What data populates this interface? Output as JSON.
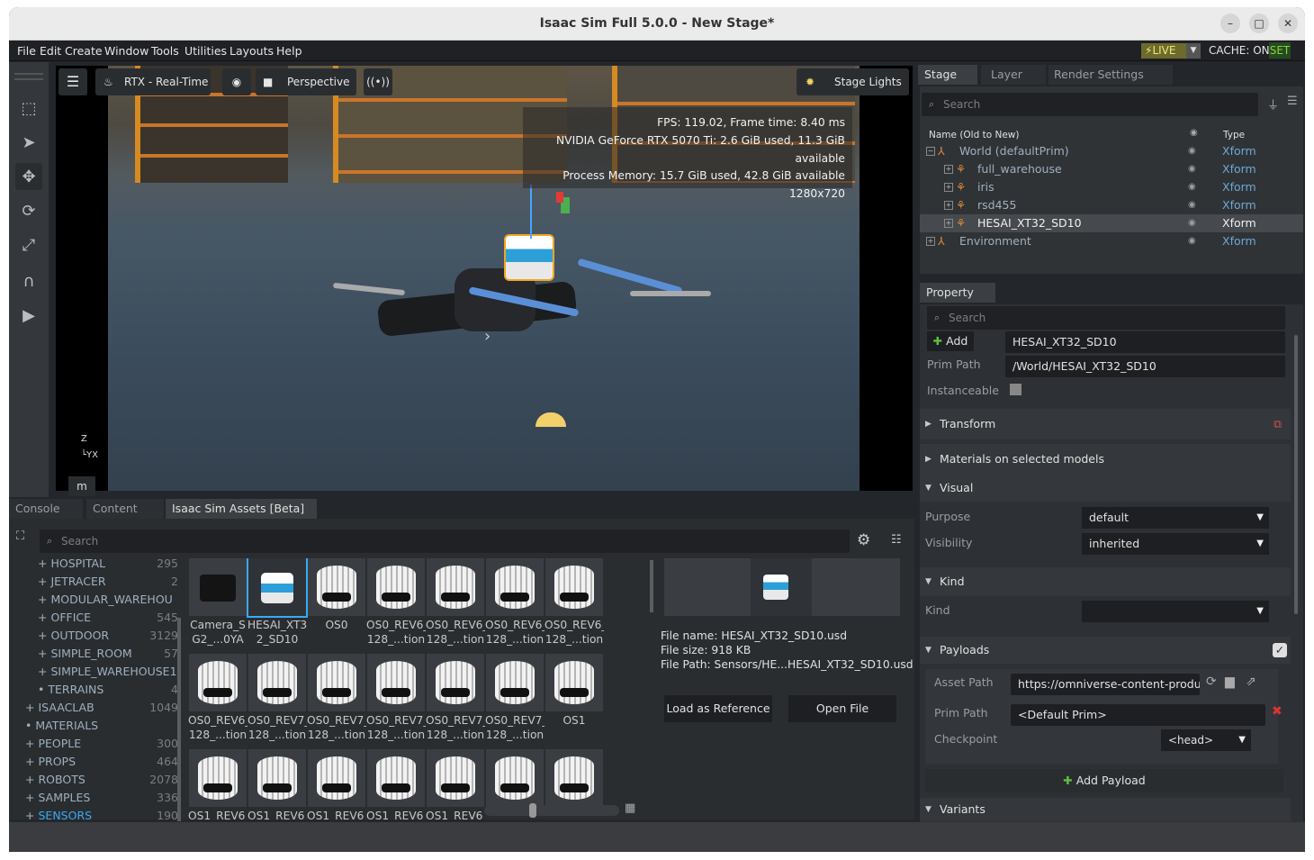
{
  "window": {
    "title": "Isaac Sim Full 5.0.0 - New Stage*",
    "minimize": "–",
    "maximize": "□",
    "close": "✕"
  },
  "menu": [
    "File",
    "Edit",
    "Create",
    "Window",
    "Tools",
    "Utilities",
    "Layouts",
    "Help"
  ],
  "status_bar": {
    "live": "LIVE",
    "cache": "CACHE: ON|",
    "set": "SET"
  },
  "viewport": {
    "renderer": "RTX - Real-Time",
    "camera": "Perspective",
    "lights": "Stage Lights",
    "stats": [
      "FPS: 119.02, Frame time: 8.40 ms",
      "NVIDIA GeForce RTX 5070 Ti: 2.6 GiB used, 11.3 GiB available",
      "Process Memory: 15.7 GiB used, 42.8 GiB available",
      "1280x720"
    ],
    "axis_z": "Z",
    "axis_y": "Y",
    "axis_x": "X",
    "unit": "m"
  },
  "right_tabs": [
    "Stage",
    "Layer",
    "Render Settings"
  ],
  "stage": {
    "search_placeholder": "Search",
    "col_name": "Name (Old to New)",
    "col_type": "Type",
    "items": [
      {
        "name": "World (defaultPrim)",
        "type": "Xform",
        "expander": "−"
      },
      {
        "name": "full_warehouse",
        "type": "Xform",
        "expander": "+"
      },
      {
        "name": "iris",
        "type": "Xform",
        "expander": "+"
      },
      {
        "name": "rsd455",
        "type": "Xform",
        "expander": "+"
      },
      {
        "name": "HESAI_XT32_SD10",
        "type": "Xform",
        "expander": "+"
      },
      {
        "name": "Environment",
        "type": "Xform",
        "expander": "+"
      }
    ]
  },
  "property": {
    "tab": "Property",
    "search_placeholder": "Search",
    "add_label": "Add",
    "name_value": "HESAI_XT32_SD10",
    "prim_path_label": "Prim Path",
    "prim_path_value": "/World/HESAI_XT32_SD10",
    "instanceable_label": "Instanceable",
    "sections": {
      "transform": "Transform",
      "materials": "Materials on selected models",
      "visual": "Visual",
      "kind": "Kind",
      "payloads": "Payloads",
      "variants": "Variants"
    },
    "purpose_label": "Purpose",
    "purpose_value": "default",
    "visibility_label": "Visibility",
    "visibility_value": "inherited",
    "kind_label": "Kind",
    "kind_value": "",
    "asset_path_label": "Asset Path",
    "asset_path_value": "https://omniverse-content-producti",
    "payload_prim_path_label": "Prim Path",
    "payload_prim_path_value": "<Default Prim>",
    "checkpoint_label": "Checkpoint",
    "checkpoint_value": "<head>",
    "add_payload": "Add Payload"
  },
  "bottom_tabs": [
    "Console",
    "Content",
    "Isaac Sim Assets [Beta]"
  ],
  "assets": {
    "search_placeholder": "Search",
    "categories": [
      {
        "label": "HOSPITAL",
        "count": "295",
        "prefix": "+",
        "indent": true
      },
      {
        "label": "JETRACER",
        "count": "2",
        "prefix": "+",
        "indent": true
      },
      {
        "label": "MODULAR_WAREHOU",
        "count": "",
        "prefix": "+",
        "indent": true
      },
      {
        "label": "OFFICE",
        "count": "545",
        "prefix": "+",
        "indent": true
      },
      {
        "label": "OUTDOOR",
        "count": "3129",
        "prefix": "+",
        "indent": true
      },
      {
        "label": "SIMPLE_ROOM",
        "count": "57",
        "prefix": "+",
        "indent": true
      },
      {
        "label": "SIMPLE_WAREHOUSE1",
        "count": "",
        "prefix": "+",
        "indent": true
      },
      {
        "label": "TERRAINS",
        "count": "4",
        "prefix": "•",
        "indent": true
      },
      {
        "label": "ISAACLAB",
        "count": "1049",
        "prefix": "+",
        "indent": false
      },
      {
        "label": "MATERIALS",
        "count": "",
        "prefix": "•",
        "indent": false
      },
      {
        "label": "PEOPLE",
        "count": "300",
        "prefix": "+",
        "indent": false
      },
      {
        "label": "PROPS",
        "count": "464",
        "prefix": "+",
        "indent": false
      },
      {
        "label": "ROBOTS",
        "count": "2078",
        "prefix": "+",
        "indent": false
      },
      {
        "label": "SAMPLES",
        "count": "336",
        "prefix": "+",
        "indent": false
      },
      {
        "label": "SENSORS",
        "count": "190",
        "prefix": "+",
        "indent": false
      }
    ],
    "tiles": [
      [
        "Camera_S",
        "G2_...0YA"
      ],
      [
        "HESAI_XT3",
        "2_SD10"
      ],
      [
        "OS0",
        ""
      ],
      [
        "OS0_REV6_",
        "128_...tion"
      ],
      [
        "OS0_REV6_",
        "128_...tion"
      ],
      [
        "OS0_REV6_",
        "128_...tion"
      ],
      [
        "OS0_REV6_",
        "128_...tion"
      ],
      [
        "OS0_REV6_",
        "128_...tion"
      ],
      [
        "OS0_REV7_",
        "128_...tion"
      ],
      [
        "OS0_REV7_",
        "128_...tion"
      ],
      [
        "OS0_REV7_",
        "128_...tion"
      ],
      [
        "OS0_REV7_",
        "128_...tion"
      ],
      [
        "OS0_REV7_",
        "128_...tion"
      ],
      [
        "OS1",
        ""
      ],
      [
        "OS1_REV6_",
        ""
      ],
      [
        "OS1_REV6_",
        ""
      ],
      [
        "OS1_REV6_",
        ""
      ],
      [
        "OS1_REV6_",
        ""
      ],
      [
        "OS1_REV6_",
        ""
      ],
      [
        "",
        ""
      ],
      [
        "",
        ""
      ]
    ],
    "file_name": "File name: HESAI_XT32_SD10.usd",
    "file_size": "File size: 918 KB",
    "file_path": "File Path: Sensors/HE...HESAI_XT32_SD10.usd",
    "load_ref": "Load as Reference",
    "open_file": "Open File"
  }
}
